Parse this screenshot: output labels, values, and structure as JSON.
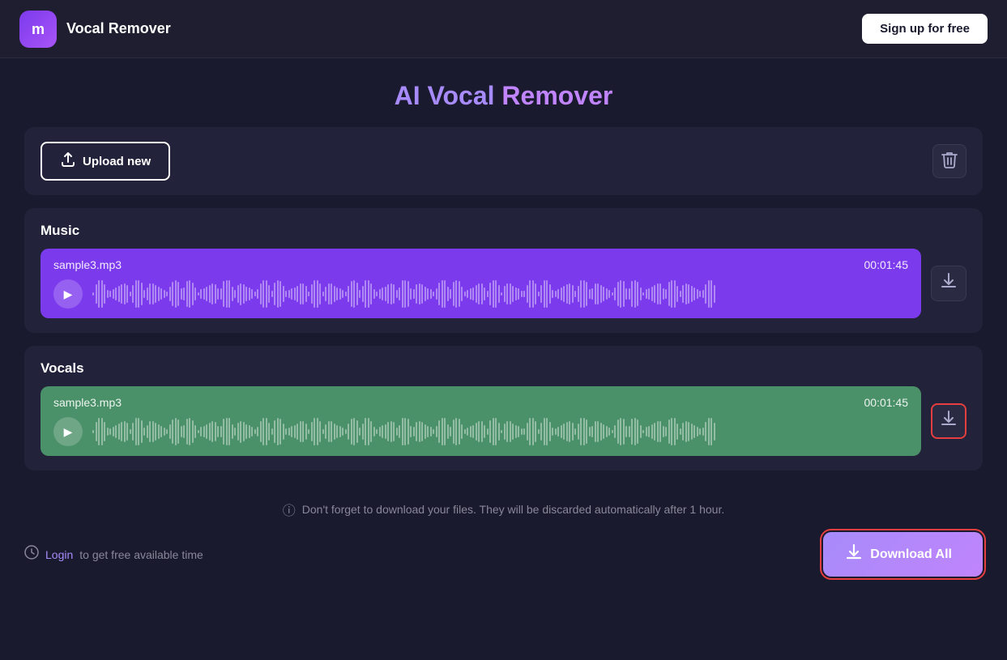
{
  "header": {
    "logo_letter": "m",
    "app_title": "Vocal Remover",
    "signup_label": "Sign up for free"
  },
  "page": {
    "title_ai": "AI",
    "title_vocal": "Vocal",
    "title_remover": "Remover"
  },
  "toolbar": {
    "upload_label": "Upload new",
    "delete_label": "🗑"
  },
  "music_section": {
    "label": "Music",
    "filename": "sample3.mp3",
    "duration": "00:01:45",
    "download_label": "⬇"
  },
  "vocals_section": {
    "label": "Vocals",
    "filename": "sample3.mp3",
    "duration": "00:01:45",
    "download_label": "⬇"
  },
  "notice": {
    "text": "Don't forget to download your files. They will be discarded automatically after 1 hour."
  },
  "footer": {
    "login_prefix": "",
    "login_link": "Login",
    "login_suffix": "to get free available time",
    "download_all_label": "Download All"
  }
}
